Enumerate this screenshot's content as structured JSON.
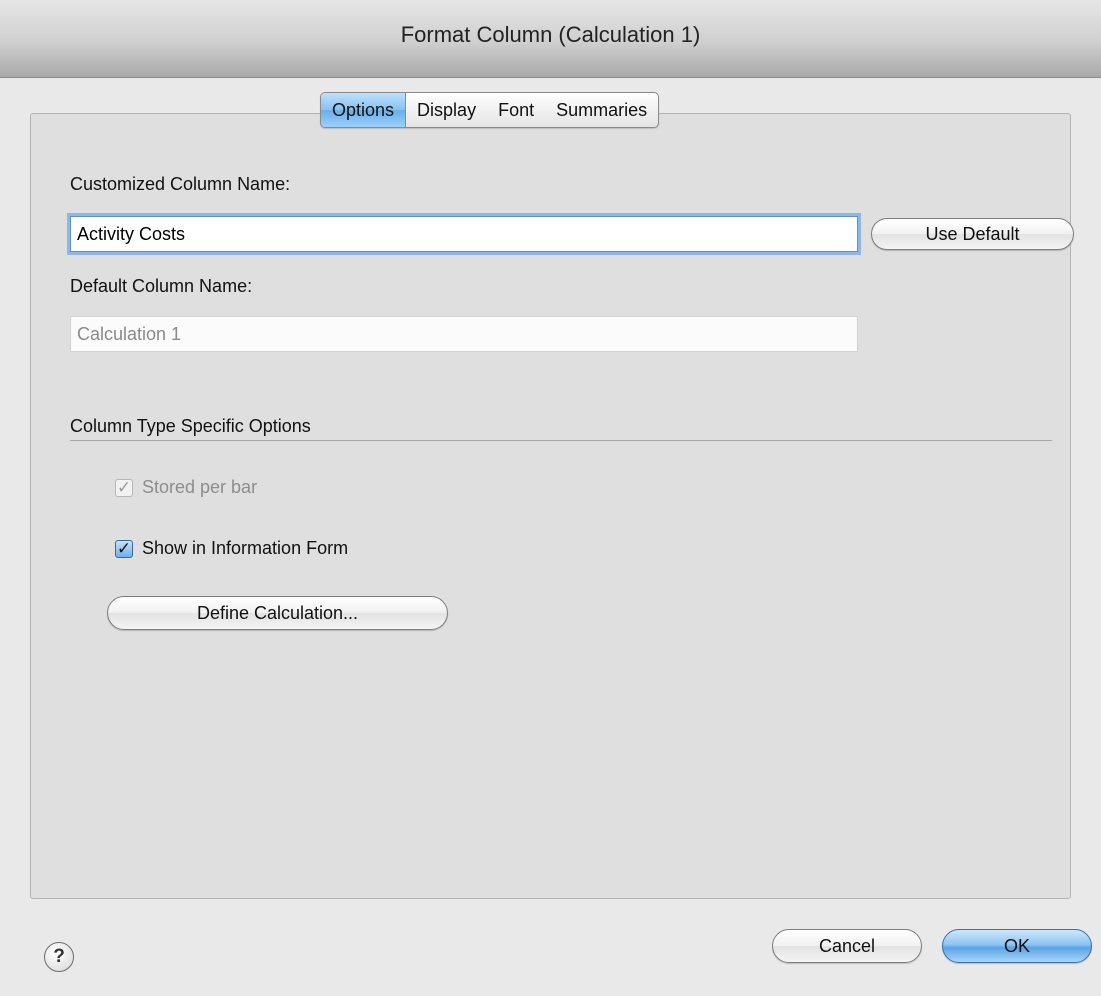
{
  "window": {
    "title": "Format Column (Calculation 1)"
  },
  "tabs": [
    {
      "label": "Options",
      "active": true
    },
    {
      "label": "Display",
      "active": false
    },
    {
      "label": "Font",
      "active": false
    },
    {
      "label": "Summaries",
      "active": false
    }
  ],
  "options": {
    "customized_label": "Customized Column Name:",
    "customized_value": "Activity Costs",
    "use_default_button": "Use Default",
    "default_label": "Default Column Name:",
    "default_value": "Calculation 1",
    "section_title": "Column Type Specific Options",
    "stored_per_bar": {
      "label": "Stored per bar",
      "checked": true,
      "enabled": false
    },
    "show_in_form": {
      "label": "Show in Information Form",
      "checked": true,
      "enabled": true
    },
    "define_button": "Define Calculation..."
  },
  "footer": {
    "help_glyph": "?",
    "cancel_button": "Cancel",
    "ok_button": "OK"
  }
}
